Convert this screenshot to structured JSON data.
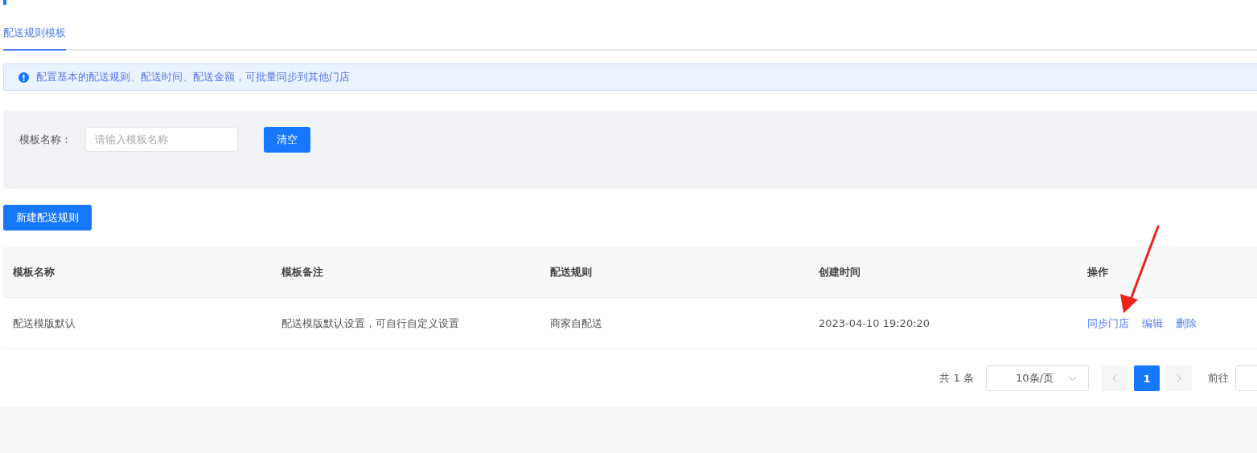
{
  "tabs": [
    {
      "label": "配送规则模板",
      "selected": true
    }
  ],
  "alert": {
    "text": "配置基本的配送规则、配送时间、配送金额，可批量同步到其他门店"
  },
  "filter": {
    "label": "模板名称：",
    "placeholder": "请输入模板名称",
    "button": "清空"
  },
  "create_button": "新建配送规则",
  "table": {
    "columns": [
      "模板名称",
      "模板备注",
      "配送规则",
      "创建时间",
      "操作"
    ],
    "rows": [
      {
        "cells": [
          "配送模版默认",
          "配送模版默认设置，可自行自定义设置",
          "商家自配送",
          "2023-04-10 19:20:20"
        ],
        "actions": [
          "同步门店",
          "编辑",
          "删除"
        ]
      }
    ]
  },
  "pagination": {
    "total": "共 1 条",
    "page_size": "10条/页",
    "pages": [
      {
        "label": "1",
        "selected": true
      }
    ],
    "goto_label": "前往"
  }
}
